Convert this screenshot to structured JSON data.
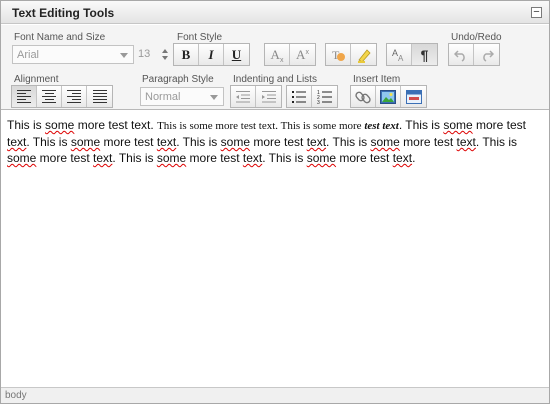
{
  "panel": {
    "title": "Text Editing Tools",
    "collapse_symbol": "−"
  },
  "toolbar": {
    "font_group_label": "Font Name and Size",
    "font_name": "Arial",
    "font_size": "13",
    "style_group_label": "Font Style",
    "bold_label": "B",
    "italic_label": "I",
    "underline_label": "U",
    "subscript_label": "A",
    "superscript_label": "A",
    "undo_group_label": "Undo/Redo",
    "align_group_label": "Alignment",
    "paragraph_group_label": "Paragraph Style",
    "paragraph_style": "Normal",
    "indent_group_label": "Indenting and Lists",
    "insert_group_label": "Insert Item"
  },
  "editor": {
    "seg1": "This is ",
    "w_some1": "some",
    "seg2": " more test text. ",
    "serif1": "This is some more test text. This is some more ",
    "bolditalic": "test text",
    "seg3": ". This is ",
    "w_some2": "some",
    "seg4": " more test ",
    "w_text1": "text",
    "seg5": ". This is ",
    "w_some3": "some",
    "seg6": " more test ",
    "w_text2": "text",
    "seg7": ". This is ",
    "w_some4": "some",
    "seg8": " more test ",
    "w_text3": "text",
    "seg9": ". This is ",
    "w_some5": "some",
    "seg10": " more test ",
    "w_text4": "text",
    "seg11": ". This is ",
    "w_some6": "some",
    "seg12": " more test ",
    "w_text5": "text",
    "seg13": ". This is ",
    "w_some7": "some",
    "seg14": " more test ",
    "w_text6": "text",
    "seg15": ". This is ",
    "w_some8": "some",
    "seg16": " more test ",
    "w_text7": "text",
    "seg17": "."
  },
  "status": {
    "path": "body"
  },
  "icons": [
    "bold-icon",
    "italic-icon",
    "underline-icon",
    "subscript-icon",
    "superscript-icon",
    "text-color-icon",
    "highlight-icon",
    "font-size-icon",
    "show-formatting-icon",
    "undo-icon",
    "redo-icon",
    "align-left-icon",
    "align-center-icon",
    "align-right-icon",
    "align-justify-icon",
    "outdent-icon",
    "indent-icon",
    "bullet-list-icon",
    "numbered-list-icon",
    "link-icon",
    "image-icon",
    "table-icon"
  ]
}
